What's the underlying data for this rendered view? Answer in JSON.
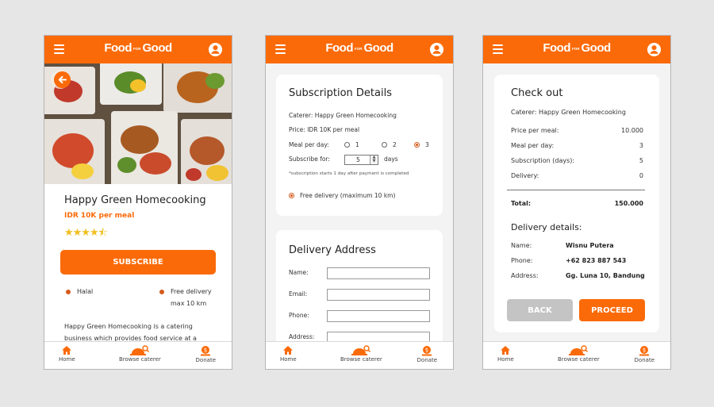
{
  "app": {
    "brand_left": "Food",
    "brand_mid": "FOR",
    "brand_right": "Good"
  },
  "colors": {
    "brand": "#fb6a08",
    "star": "#f0c01f",
    "muted_button": "#c4c4c4"
  },
  "icons": {
    "menu": "hamburger-menu-icon",
    "account": "account-icon",
    "back": "back-arrow-icon",
    "home": "home-icon",
    "browse": "browse-caterer-icon",
    "donate": "donate-icon"
  },
  "nav": {
    "home": "Home",
    "browse": "Browse caterer",
    "donate": "Donate"
  },
  "screen1": {
    "caterer_name": "Happy Green Homecooking",
    "price": "IDR 10K per meal",
    "rating": 4.5,
    "stars": "★★★★⯪",
    "subscribe_label": "SUBSCRIBE",
    "feature_1": "Halal",
    "feature_2_line1": "Free delivery",
    "feature_2_line2": "max 10 km",
    "description": "Happy Green Homecooking is a catering business which provides food service at a"
  },
  "screen2": {
    "subscription_title": "Subscription Details",
    "caterer_line": "Caterer: Happy Green Homecooking",
    "price_line": "Price: IDR 10K per meal",
    "meal_per_day_label": "Meal per day:",
    "meal_options": [
      "1",
      "2",
      "3"
    ],
    "meal_selected": "3",
    "subscribe_for_label": "Subscribe for:",
    "subscribe_days_value": "5",
    "days_label": "days",
    "note": "*subscription starts 1 day after payment is completed",
    "free_delivery": "Free delivery (maximum 10 km)",
    "address_title": "Delivery Address",
    "fields": {
      "name": "Name:",
      "email": "Email:",
      "phone": "Phone:",
      "address": "Address:"
    }
  },
  "screen3": {
    "title": "Check out",
    "caterer_line": "Caterer: Happy Green Homecooking",
    "rows": [
      {
        "label": "Price per meal:",
        "value": "10.000"
      },
      {
        "label": "Meal per day:",
        "value": "3"
      },
      {
        "label": "Subscription (days):",
        "value": "5"
      },
      {
        "label": "Delivery:",
        "value": "0"
      }
    ],
    "total_label": "Total:",
    "total_value": "150.000",
    "delivery_title": "Delivery details:",
    "details": [
      {
        "label": "Name:",
        "value": "Wisnu Putera"
      },
      {
        "label": "Phone:",
        "value": "+62 823 887 543"
      },
      {
        "label": "Address:",
        "value": "Gg. Luna 10, Bandung"
      }
    ],
    "back_label": "BACK",
    "proceed_label": "PROCEED"
  }
}
